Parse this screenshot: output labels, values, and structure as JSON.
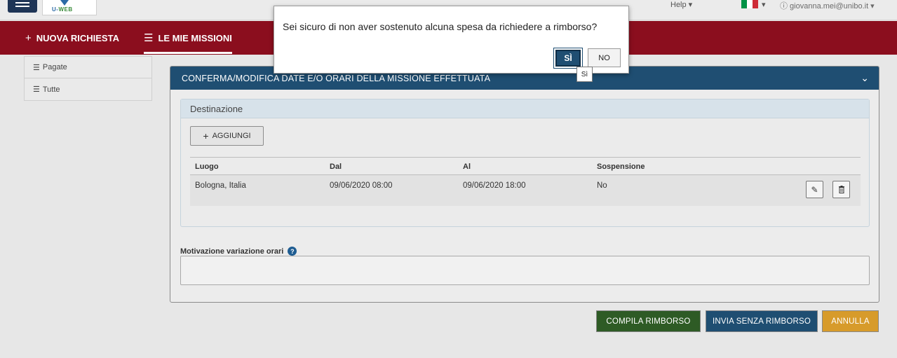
{
  "header": {
    "logo_text_left": "U-",
    "logo_text_right": "WEB",
    "help_label": "Help ▾",
    "help_icon": "help-circle-icon",
    "user_label": "ⓘ giovanna.mei@unibo.it ▾",
    "flag_colors": [
      "#009246",
      "#ffffff",
      "#ce2b37"
    ]
  },
  "nav": {
    "new_request_label": "NUOVA RICHIESTA",
    "my_missions_label": "LE MIE MISSIONI"
  },
  "sidebar": {
    "items": [
      {
        "label": "Pagate"
      },
      {
        "label": "Tutte"
      }
    ]
  },
  "panel": {
    "title": "CONFERMA/MODIFICA DATE E/O ORARI DELLA MISSIONE EFFETTUATA",
    "destination": {
      "title": "Destinazione",
      "add_label": "AGGIUNGI",
      "columns": [
        "Luogo",
        "Dal",
        "Al",
        "Sospensione"
      ],
      "rows": [
        {
          "luogo": "Bologna, Italia",
          "dal": "09/06/2020 08:00",
          "al": "09/06/2020 18:00",
          "sospensione": "No"
        }
      ]
    },
    "motivation_label": "Motivazione variazione orari",
    "motivation_value": ""
  },
  "footer": {
    "compile_label": "COMPILA RIMBORSO",
    "send_label": "INVIA SENZA RIMBORSO",
    "cancel_label": "ANNULLA"
  },
  "modal": {
    "message": "Sei sicuro di non aver sostenuto alcuna spesa da richiedere a rimborso?",
    "yes_label": "SÌ",
    "no_label": "NO",
    "tooltip": "Sì"
  },
  "colors": {
    "nav_bg": "#8b0e1e",
    "panel_header": "#1f4e72",
    "green_btn": "#2e5b25",
    "orange_btn": "#d79b2b"
  }
}
